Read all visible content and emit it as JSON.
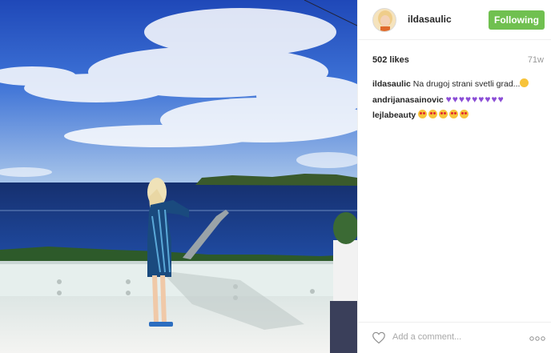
{
  "post": {
    "username": "ildasaulic",
    "follow_label": "Following",
    "likes": "502 likes",
    "time_ago": "71w",
    "comment_placeholder": "Add a comment...",
    "comments": [
      {
        "author": "ildasaulic",
        "text": "Na drugoj strani svetli grad...",
        "emoji": "smiling-face"
      },
      {
        "author": "andrijanasainovic",
        "text": "",
        "emoji": "purple-heart x9"
      },
      {
        "author": "lejlabeauty",
        "text": "",
        "emoji": "heart-eyes-face x5"
      }
    ]
  },
  "colors": {
    "follow_button": "#70c050",
    "text": "#262626",
    "muted": "#999999",
    "heart": "#8b4dd6"
  },
  "icons": [
    "heart-outline-icon",
    "more-options-icon"
  ]
}
